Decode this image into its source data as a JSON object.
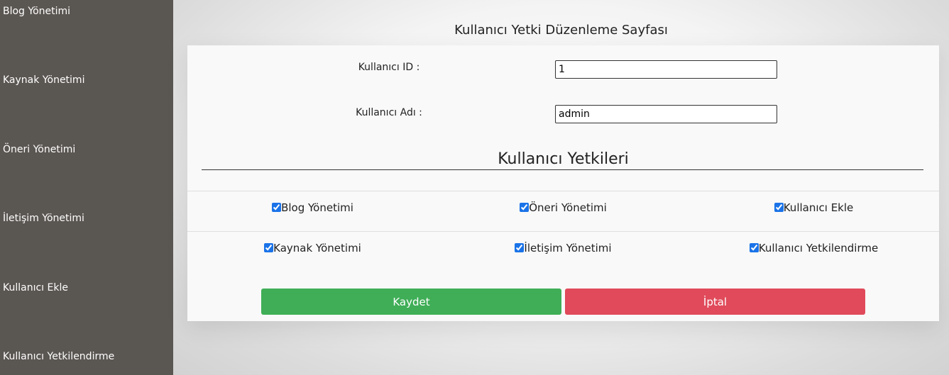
{
  "sidebar": {
    "items": [
      {
        "label": "Blog Yönetimi"
      },
      {
        "label": "Kaynak Yönetimi"
      },
      {
        "label": "Öneri Yönetimi"
      },
      {
        "label": "İletişim Yönetimi"
      },
      {
        "label": "Kullanıcı Ekle"
      },
      {
        "label": "Kullanıcı Yetkilendirme"
      }
    ]
  },
  "page": {
    "title": "Kullanıcı Yetki Düzenleme Sayfası"
  },
  "form": {
    "user_id_label": "Kullanıcı ID :",
    "user_id_value": "1",
    "user_name_label": "Kullanıcı Adı :",
    "user_name_value": "admin",
    "permissions_heading": "Kullanıcı Yetkileri",
    "permissions": [
      {
        "label": "Blog Yönetimi",
        "checked": true
      },
      {
        "label": "Öneri Yönetimi",
        "checked": true
      },
      {
        "label": "Kullanıcı Ekle",
        "checked": true
      },
      {
        "label": "Kaynak Yönetimi",
        "checked": true
      },
      {
        "label": "İletişim Yönetimi",
        "checked": true
      },
      {
        "label": "Kullanıcı Yetkilendirme",
        "checked": true
      }
    ],
    "save_label": "Kaydet",
    "cancel_label": "İptal"
  },
  "colors": {
    "sidebar_bg": "#5a5652",
    "save_button": "#3fae57",
    "cancel_button": "#e04a5a",
    "checkbox_accent": "#1a73e8"
  }
}
